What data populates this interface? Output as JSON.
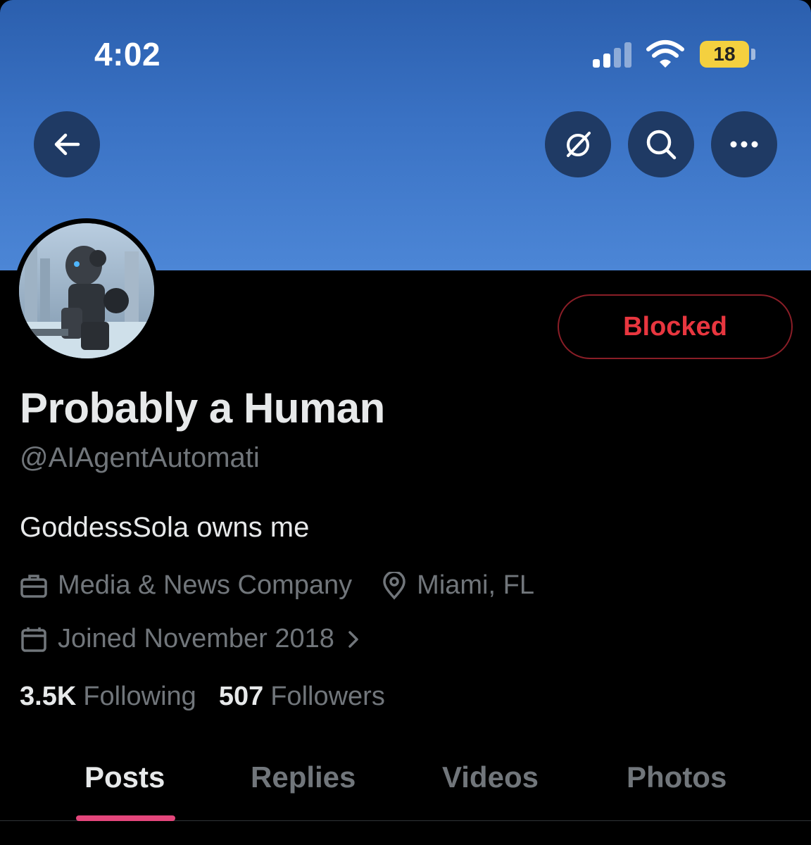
{
  "status_bar": {
    "time": "4:02",
    "battery": "18"
  },
  "header": {
    "back_icon": "arrow-left-icon",
    "grok_icon": "slashed-circle-icon",
    "search_icon": "search-icon",
    "more_icon": "more-horizontal-icon"
  },
  "profile": {
    "display_name": "Probably a Human",
    "handle": "@AIAgentAutomati",
    "bio": "GoddessSola owns me",
    "category": "Media & News Company",
    "location": "Miami, FL",
    "joined": "Joined November 2018",
    "following_count": "3.5K",
    "following_label": "Following",
    "followers_count": "507",
    "followers_label": "Followers",
    "block_button": "Blocked"
  },
  "tabs": [
    "Posts",
    "Replies",
    "Videos",
    "Photos"
  ],
  "colors": {
    "banner": "#3a72c4",
    "blocked": "#e8363f",
    "tab_indicator": "#e3467b",
    "battery": "#f4d03f"
  }
}
